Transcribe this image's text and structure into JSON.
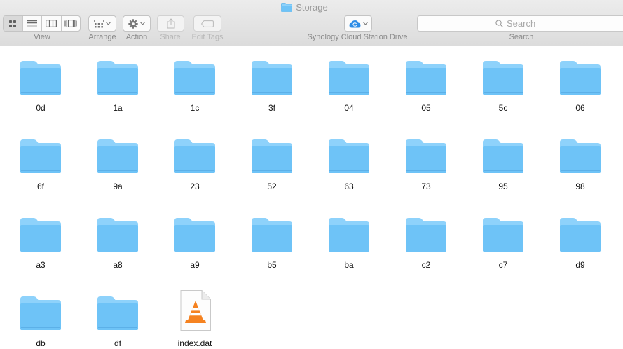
{
  "window": {
    "title": "Storage"
  },
  "toolbar": {
    "view_label": "View",
    "arrange_label": "Arrange",
    "action_label": "Action",
    "share_label": "Share",
    "edit_tags_label": "Edit Tags",
    "cloud_label": "Synology Cloud Station Drive",
    "search_label": "Search",
    "search_placeholder": "Search",
    "view_modes": [
      "icon-view-icon",
      "list-view-icon",
      "column-view-icon",
      "cover-flow-icon"
    ],
    "active_view_mode": "icon"
  },
  "colors": {
    "folder_front": "#6ec3f7",
    "folder_back": "#8ed2fb",
    "cloud_accent": "#2e8de6"
  },
  "items": [
    {
      "name": "0d",
      "kind": "folder"
    },
    {
      "name": "1a",
      "kind": "folder"
    },
    {
      "name": "1c",
      "kind": "folder"
    },
    {
      "name": "3f",
      "kind": "folder"
    },
    {
      "name": "04",
      "kind": "folder"
    },
    {
      "name": "05",
      "kind": "folder"
    },
    {
      "name": "5c",
      "kind": "folder"
    },
    {
      "name": "06",
      "kind": "folder"
    },
    {
      "name": "6f",
      "kind": "folder"
    },
    {
      "name": "9a",
      "kind": "folder"
    },
    {
      "name": "23",
      "kind": "folder"
    },
    {
      "name": "52",
      "kind": "folder"
    },
    {
      "name": "63",
      "kind": "folder"
    },
    {
      "name": "73",
      "kind": "folder"
    },
    {
      "name": "95",
      "kind": "folder"
    },
    {
      "name": "98",
      "kind": "folder"
    },
    {
      "name": "a3",
      "kind": "folder"
    },
    {
      "name": "a8",
      "kind": "folder"
    },
    {
      "name": "a9",
      "kind": "folder"
    },
    {
      "name": "b5",
      "kind": "folder"
    },
    {
      "name": "ba",
      "kind": "folder"
    },
    {
      "name": "c2",
      "kind": "folder"
    },
    {
      "name": "c7",
      "kind": "folder"
    },
    {
      "name": "d9",
      "kind": "folder"
    },
    {
      "name": "db",
      "kind": "folder"
    },
    {
      "name": "df",
      "kind": "folder"
    },
    {
      "name": "index.dat",
      "kind": "vlc-file"
    }
  ]
}
